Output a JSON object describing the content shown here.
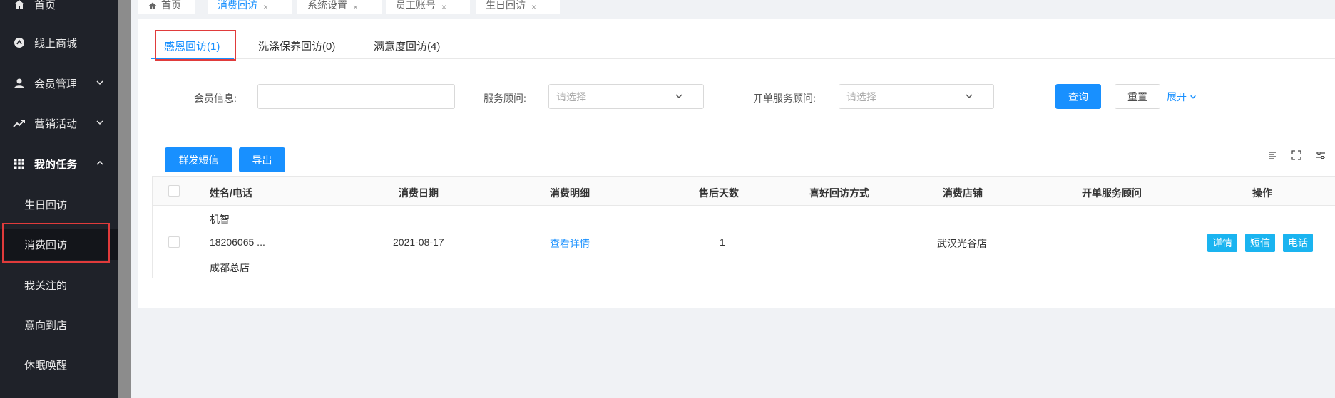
{
  "sidebar": {
    "items": [
      {
        "label": "首页",
        "icon": "home-icon"
      },
      {
        "label": "线上商城",
        "icon": "store-icon"
      },
      {
        "label": "会员管理",
        "icon": "user-icon"
      },
      {
        "label": "营销活动",
        "icon": "trend-icon"
      },
      {
        "label": "我的任务",
        "icon": "grid-icon"
      }
    ],
    "sub_items": [
      {
        "label": "生日回访"
      },
      {
        "label": "消费回访"
      },
      {
        "label": "我关注的"
      },
      {
        "label": "意向到店"
      },
      {
        "label": "休眠唤醒"
      }
    ]
  },
  "page_tabs": [
    {
      "label": "首页"
    },
    {
      "label": "消费回访"
    },
    {
      "label": "系统设置"
    },
    {
      "label": "员工账号"
    },
    {
      "label": "生日回访"
    }
  ],
  "sub_tabs": [
    {
      "label": "感恩回访(1)"
    },
    {
      "label": "洗涤保养回访(0)"
    },
    {
      "label": "满意度回访(4)"
    }
  ],
  "filters": {
    "member_info_label": "会员信息:",
    "service_advisor_label": "服务顾问:",
    "service_advisor_placeholder": "请选择",
    "order_advisor_label": "开单服务顾问:",
    "order_advisor_placeholder": "请选择",
    "query_button": "查询",
    "reset_button": "重置",
    "expand_link": "展开"
  },
  "toolbar": {
    "bulk_sms_button": "群发短信",
    "export_button": "导出"
  },
  "table": {
    "columns": [
      "姓名/电话",
      "消费日期",
      "消费明细",
      "售后天数",
      "喜好回访方式",
      "消费店铺",
      "开单服务顾问",
      "操作"
    ],
    "rows": [
      {
        "name": "机智",
        "phone": "18206065 ...",
        "store_origin": "成都总店",
        "date": "2021-08-17",
        "detail_link": "查看详情",
        "days": "1",
        "preferred_method": "",
        "shop": "武汉光谷店",
        "advisor": "",
        "actions": [
          "详情",
          "短信",
          "电话"
        ]
      }
    ]
  },
  "colors": {
    "accent": "#1890ff",
    "action": "#1ab4f0",
    "highlight": "#e03b3b",
    "sidebar_bg": "#1f2229"
  }
}
